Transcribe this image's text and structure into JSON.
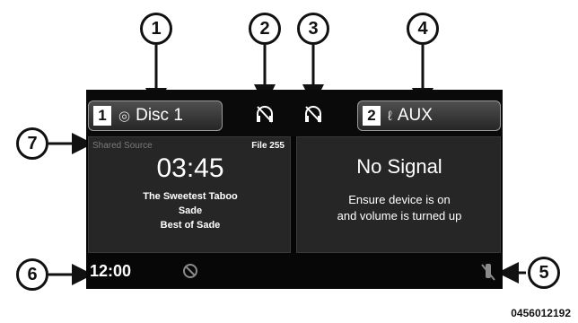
{
  "callouts": [
    "1",
    "2",
    "3",
    "4",
    "5",
    "6",
    "7"
  ],
  "topbar": {
    "source1": {
      "number": "1",
      "icon": "disc-icon",
      "label": "Disc 1"
    },
    "source2": {
      "number": "2",
      "icon": "aux-icon",
      "label": "AUX"
    },
    "headphone_icons": [
      "headphones-off-icon",
      "headphones-off-icon"
    ]
  },
  "left_panel": {
    "shared_source": "Shared Source",
    "file": "File 255",
    "time": "03:45",
    "song": "The Sweetest Taboo",
    "artist": "Sade",
    "album": "Best of Sade"
  },
  "right_panel": {
    "status": "No Signal",
    "hint_line1": "Ensure device is on",
    "hint_line2": "and volume is turned up"
  },
  "bottombar": {
    "clock": "12:00",
    "left_icon": "no-symbol-icon",
    "right_icon": "remote-off-icon"
  },
  "figure_code": "0456012192",
  "colors": {
    "screen": "#050505",
    "panel": "#262626",
    "button_border": "#9a9a9a"
  }
}
